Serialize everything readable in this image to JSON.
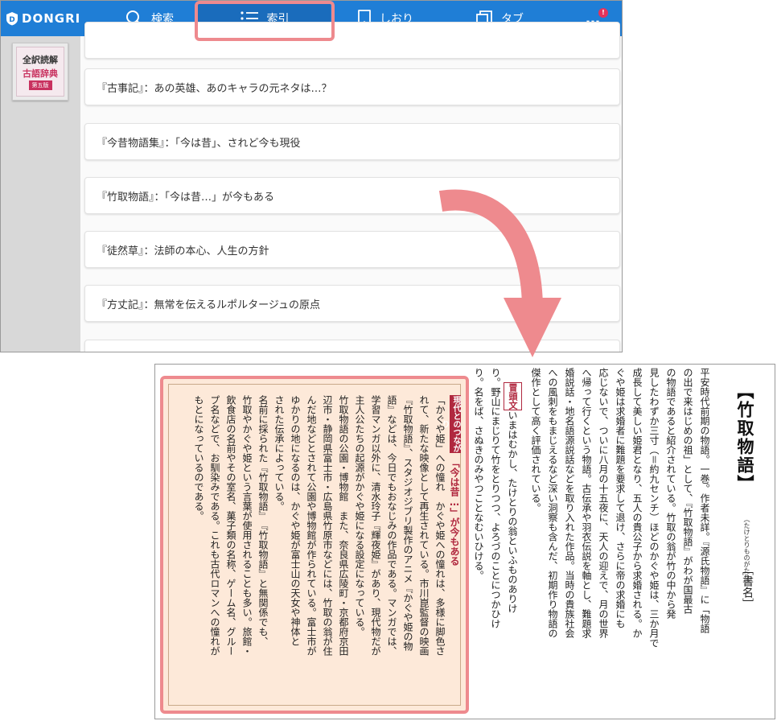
{
  "toolbar": {
    "logo": "DONGRI",
    "search_label": "検索",
    "index_label": "索引",
    "bookmark_label": "しおり",
    "tabs_label": "タブ",
    "more_label": "…",
    "more_badge": "!"
  },
  "sidebar": {
    "cover_line1": "全訳読解",
    "cover_line2": "古語辞典",
    "cover_edition": "第五版"
  },
  "list": {
    "items": [
      "『古事記』：あの英雄、あのキャラの元ネタは…？",
      "『今昔物語集』：「今は昔」、されど今も現役",
      "『竹取物語』：「今は昔…」が今もある",
      "『徒然草』：法師の本心、人生の方針",
      "『方丈記』：無常を伝えるルポルタージュの原点"
    ]
  },
  "entry": {
    "title": "【竹取物語】",
    "reading": "（たけとりものがたり）",
    "category": "［書名］",
    "body_lines": [
      "平安時代前期の物語。一巻。作者未詳。『源氏物語』に「物語",
      "の出で来はじめの祖」として、『竹取物語』がわが国最古",
      "の物語であると紹介されている。竹取の翁が竹の中から発",
      "見したわずか三寸（＝約九センチ）ほどのかぐや姫は、三か月で",
      "成長して美しい姫君となり、五人の貴公子から求婚される。か",
      "ぐや姫は求婚者に難題を要求して退け、さらに帝の求婚にも",
      "応じないで、ついに八月の十五夜に、天人の迎えで、月の世界",
      "へ帰って行くという物語。古伝承や羽衣伝説を軸とし、難題求",
      "婚説話・地名語源説話などを取り入れた作品。当時の貴族社会",
      "への風刺をもまじえるなど深い洞察も含んだ、初期作り物語の",
      "傑作として高く評価されている。"
    ],
    "opening_label": "冒頭文",
    "opening_lines": [
      "いまはむかし、たけとりの翁といふものありけ",
      "り。野山にまじりて竹をとりつつ、よろづのことにつかひけ",
      "り。名をば、さぬきのみやつことなむいひける。"
    ]
  },
  "column": {
    "tag": "現代とのつながり",
    "heading": "「今は昔…」が今もある",
    "lines": [
      "「かぐや姫」への憧れ　かぐや姫への憧れは、多様に脚色さ",
      "れて、新たな映像として再生されている。市川崑監督の映画",
      "『竹取物語』、スタジオジブリ製作のアニメ『かぐや姫の物",
      "語』などは、今日でもおなじみの作品である。マンガでは、",
      "学習マンガ以外に、清水玲子『輝夜姫』があり、現代物だが",
      "主人公たちの起源がかぐや姫になる設定になっている。",
      "竹取物語の公園・博物館　また、奈良県広陵町・京都府京田",
      "辺市・静岡県富士市・広島県竹原市などには、竹取の翁が住",
      "んだ地などとされて公園や博物館が作られている。富士市が",
      "ゆかりの地になるのは、かぐや姫が富士山の天女や神体と",
      "された伝承によっている。",
      "名前に採られた『竹取物語』　『竹取物語』と無関係でも、",
      "竹取やかぐや姫という言葉が使用されることも多い。旅館・",
      "飲食店の名前やその室名、菓子類の名称、ゲーム名、グルー",
      "プ名などで、お馴染みである。これも古代ロマンへの憧れが",
      "もとになっているのである。"
    ]
  },
  "colors": {
    "toolbar_blue": "#1f7ed6",
    "highlight_pink": "#ee8a8e",
    "accent_red": "#b0283f",
    "column_bg": "#fde9d9"
  }
}
